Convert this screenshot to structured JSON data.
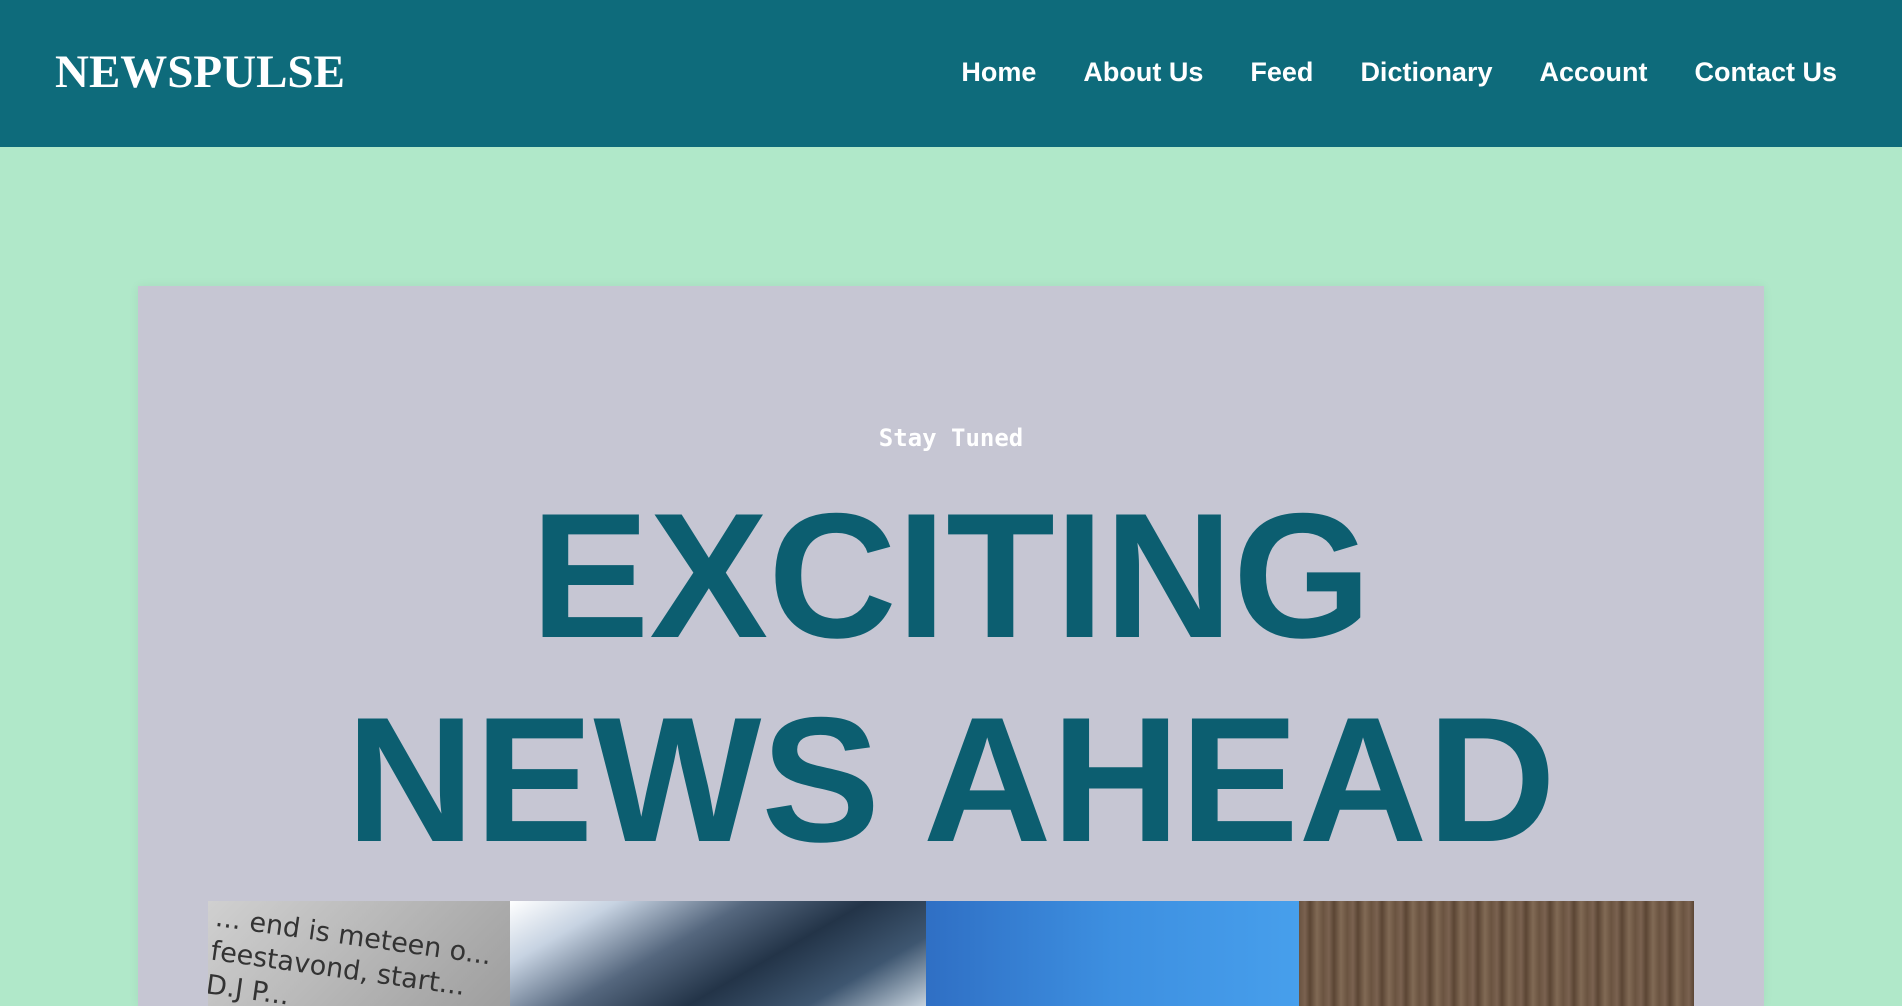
{
  "header": {
    "brand": "NEWSPULSE",
    "nav": [
      {
        "label": "Home"
      },
      {
        "label": "About Us"
      },
      {
        "label": "Feed"
      },
      {
        "label": "Dictionary"
      },
      {
        "label": "Account"
      },
      {
        "label": "Contact Us"
      }
    ]
  },
  "hero": {
    "kicker": "Stay Tuned",
    "headline_line1": "EXCITING",
    "headline_line2": "NEWS AHEAD",
    "gallery": [
      {
        "name": "newspaper-photo",
        "text_lines": [
          "... end is meteen o...",
          "feestavond, start...",
          "D.J P..."
        ]
      },
      {
        "name": "face-closeup-photo"
      },
      {
        "name": "blue-gradient-photo"
      },
      {
        "name": "wood-texture-photo"
      }
    ]
  },
  "colors": {
    "header_bg": "#0e6b7b",
    "page_bg": "#b0e8c9",
    "card_bg": "#c6c6d3",
    "headline": "#0c5e70",
    "nav_text": "#ffffff"
  }
}
